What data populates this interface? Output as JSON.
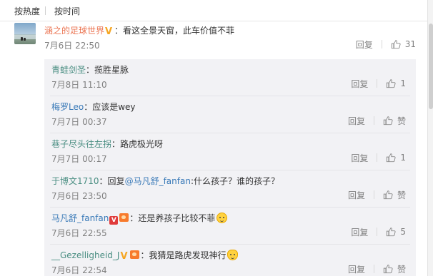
{
  "sort_tabs": {
    "hot": "按热度",
    "time": "按时间"
  },
  "main_comment": {
    "username": "涵之的足球世界",
    "sep": "：",
    "text": "看这全景天窗，此车价值不菲",
    "time": "7月6日 22:50",
    "reply_label": "回复",
    "likes": "31"
  },
  "replies": [
    {
      "username": "青蛙剑圣",
      "text": "：揽胜星脉",
      "time": "7月8日 11:10",
      "reply_label": "回复",
      "likes": "1"
    },
    {
      "username": "梅罗Leo",
      "text": "：应该是wey",
      "time": "7月7日 00:37",
      "reply_label": "回复",
      "likes": "赞"
    },
    {
      "username": "巷子尽头往左拐",
      "text": "：路虎极光呀",
      "time": "7月7日 00:17",
      "reply_label": "回复",
      "likes": "1"
    },
    {
      "username": "于博文1710",
      "text": "：回复",
      "mention": "@马凡舒_fanfan",
      "text2": ":什么孩子？谁的孩子？",
      "time": "7月6日 23:50",
      "reply_label": "回复",
      "likes": "赞"
    },
    {
      "username": "马凡舒_fanfan",
      "badge": "V",
      "text": "：还是养孩子比较不菲",
      "time": "7月6日 22:55",
      "reply_label": "回复",
      "likes": "5"
    },
    {
      "username": "__Gezelligheid_J",
      "text": "：我猜是路虎发现神行",
      "time": "7月6日 22:54",
      "reply_label": "回复",
      "likes": "赞"
    }
  ],
  "colors": {
    "link_orange": "#eb7350",
    "link_blue": "#3a7ab8",
    "badge_gold": "#f5a623",
    "reply_bg": "#f2f2f5"
  }
}
